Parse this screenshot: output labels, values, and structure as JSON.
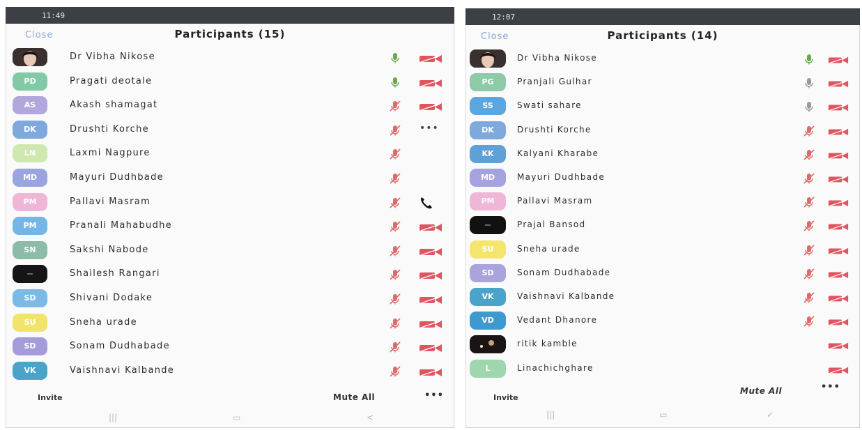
{
  "colors": {
    "mic_on": "#6aa84f",
    "mic_gray": "#9a9a9a",
    "muted": "#e06a6a",
    "video_off": "#e05560",
    "status_bar": "#3c3f44",
    "link_blue": "#8aa7d8"
  },
  "icons": {
    "mic": "microphone-icon",
    "mic_muted": "microphone-muted-icon",
    "video_off": "video-off-icon",
    "phone": "phone-icon",
    "more": "more-options-icon"
  },
  "left": {
    "status_time": "11:49",
    "status_sys": "",
    "close_label": "Close",
    "title": "Participants (15)",
    "participants": [
      {
        "initials": "",
        "name": "Dr Vibha Nikose",
        "avatar": "photo-woman",
        "color": "#3a3030",
        "mic": "on",
        "right": "video-off"
      },
      {
        "initials": "PD",
        "name": "Pragati deotale",
        "color": "#82c9a6",
        "mic": "on",
        "right": "video-off"
      },
      {
        "initials": "AS",
        "name": "Akash shamagat",
        "color": "#b3a6dc",
        "mic": "muted",
        "right": "video-off"
      },
      {
        "initials": "DK",
        "name": "Drushti Korche",
        "color": "#7fa8dc",
        "mic": "muted",
        "right": "dots"
      },
      {
        "initials": "LN",
        "name": "Laxmi Nagpure",
        "color": "#cfe8b0",
        "mic": "muted",
        "right": "none"
      },
      {
        "initials": "MD",
        "name": "Mayuri Dudhbade",
        "color": "#9aa4de",
        "mic": "muted",
        "right": "none"
      },
      {
        "initials": "PM",
        "name": "Pallavi Masram",
        "color": "#efb6d8",
        "mic": "muted",
        "right": "phone"
      },
      {
        "initials": "PM",
        "name": "Pranali Mahabudhe",
        "color": "#74b6e6",
        "mic": "muted",
        "right": "video-off"
      },
      {
        "initials": "SN",
        "name": "Sakshi Nabode",
        "color": "#8cbba7",
        "mic": "muted",
        "right": "video-off"
      },
      {
        "initials": "",
        "name": "Shailesh Rangari",
        "avatar": "dark",
        "color": "#151515",
        "mic": "muted",
        "right": "video-off"
      },
      {
        "initials": "SD",
        "name": "Shivani Dodake",
        "color": "#7bbae6",
        "mic": "muted",
        "right": "video-off"
      },
      {
        "initials": "SU",
        "name": "Sneha urade",
        "color": "#f2e36a",
        "mic": "muted",
        "right": "video-off"
      },
      {
        "initials": "SD",
        "name": "Sonam Dudhabade",
        "color": "#a49cd8",
        "mic": "muted",
        "right": "video-off"
      },
      {
        "initials": "VK",
        "name": "Vaishnavi Kalbande",
        "color": "#4aa3c9",
        "mic": "muted",
        "right": "video-off"
      }
    ],
    "invite_label": "Invite",
    "mute_all_label": "Mute All",
    "more_label": "•••",
    "nav": [
      "|||",
      "▭",
      "<"
    ]
  },
  "right": {
    "status_time": "12:07",
    "status_sys": "",
    "close_label": "Close",
    "title": "Participants (14)",
    "participants": [
      {
        "initials": "",
        "name": "Dr Vibha Nikose",
        "avatar": "photo-woman",
        "color": "#3a3030",
        "mic": "on",
        "right": "video-off"
      },
      {
        "initials": "PG",
        "name": "Pranjali Gulhar",
        "color": "#8ccaa8",
        "mic": "gray",
        "right": "video-off"
      },
      {
        "initials": "SS",
        "name": "Swati sahare",
        "color": "#5aa6e0",
        "mic": "gray",
        "right": "video-off"
      },
      {
        "initials": "DK",
        "name": "Drushti Korche",
        "color": "#7fa8dc",
        "mic": "muted",
        "right": "video-off"
      },
      {
        "initials": "KK",
        "name": "Kalyani Kharabe",
        "color": "#5fa0d6",
        "mic": "muted",
        "right": "video-off"
      },
      {
        "initials": "MD",
        "name": "Mayuri Dudhbade",
        "color": "#a6a2e0",
        "mic": "muted",
        "right": "video-off"
      },
      {
        "initials": "PM",
        "name": "Pallavi Masram",
        "color": "#efb6d8",
        "mic": "muted",
        "right": "video-off"
      },
      {
        "initials": "",
        "name": "Prajal Bansod",
        "avatar": "dark",
        "color": "#111111",
        "mic": "muted",
        "right": "video-off"
      },
      {
        "initials": "SU",
        "name": "Sneha urade",
        "color": "#f4e66c",
        "mic": "muted",
        "right": "video-off"
      },
      {
        "initials": "SD",
        "name": "Sonam Dudhabade",
        "color": "#aaa4dc",
        "mic": "muted",
        "right": "video-off"
      },
      {
        "initials": "VK",
        "name": "Vaishnavi Kalbande",
        "color": "#4aa3c9",
        "mic": "muted",
        "right": "video-off"
      },
      {
        "initials": "VD",
        "name": "Vedant Dhanore",
        "color": "#3d9ad0",
        "mic": "muted",
        "right": "video-off"
      },
      {
        "initials": "",
        "name": "ritik kamble",
        "avatar": "photo-dark",
        "color": "#1a1414",
        "mic": "none",
        "right": "video-off"
      },
      {
        "initials": "L",
        "name": "Linachichghare",
        "color": "#9fd6ae",
        "mic": "none",
        "right": "video-off"
      }
    ],
    "invite_label": "Invite",
    "mute_all_label": "Mute All",
    "more_label": "•••",
    "nav": [
      "|||",
      "▭",
      "✓"
    ]
  }
}
